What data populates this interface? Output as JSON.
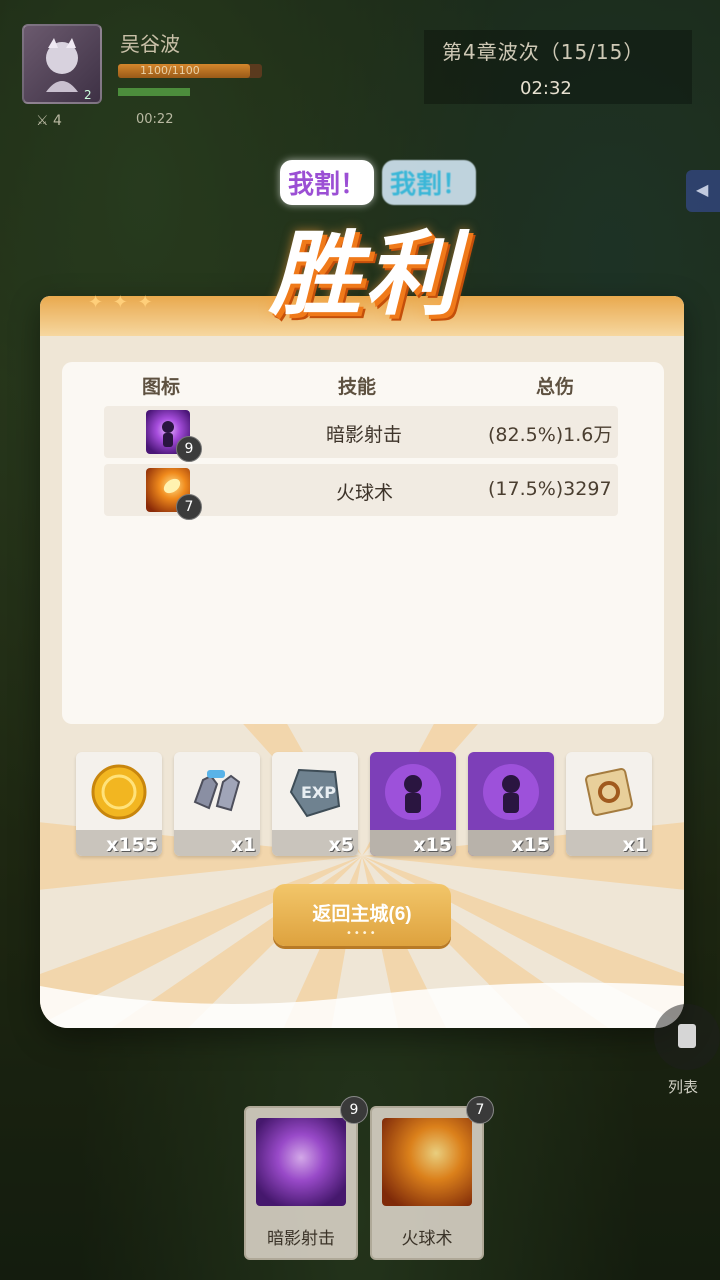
{
  "hud": {
    "player_name": "吴谷波",
    "hp_text": "1100/1100",
    "level": "2",
    "kills": "4",
    "time_small": "00:22",
    "wave": "第4章波次（15/15）",
    "clock": "02:32"
  },
  "chat": {
    "msg1": "我割！",
    "msg2": "我割！"
  },
  "banner": {
    "title": "胜利"
  },
  "table": {
    "headers": {
      "icon": "图标",
      "skill": "技能",
      "damage": "总伤"
    },
    "rows": [
      {
        "icon": "shadow-shot-icon",
        "level": "9",
        "name": "暗影射击",
        "damage": "(82.5%)1.6万"
      },
      {
        "icon": "fireball-icon",
        "level": "7",
        "name": "火球术",
        "damage": "(17.5%)3297"
      }
    ]
  },
  "rewards": [
    {
      "icon": "gold-coin-icon",
      "qty": "x155"
    },
    {
      "icon": "gauntlet-icon",
      "qty": "x1"
    },
    {
      "icon": "exp-stone-icon",
      "qty": "x5"
    },
    {
      "icon": "shadow-skill-icon",
      "qty": "x15"
    },
    {
      "icon": "shadow-skill-icon",
      "qty": "x15"
    },
    {
      "icon": "scroll-icon",
      "qty": "x1"
    }
  ],
  "buttons": {
    "return": "返回主城(6)"
  },
  "dock": {
    "list_label": "列表",
    "cards": [
      {
        "name": "暗影射击",
        "level": "9"
      },
      {
        "name": "火球术",
        "level": "7"
      }
    ]
  },
  "colors": {
    "accent": "#dea23e",
    "victory_text": "#ffffff",
    "victory_shadow": "#f07a1a"
  }
}
